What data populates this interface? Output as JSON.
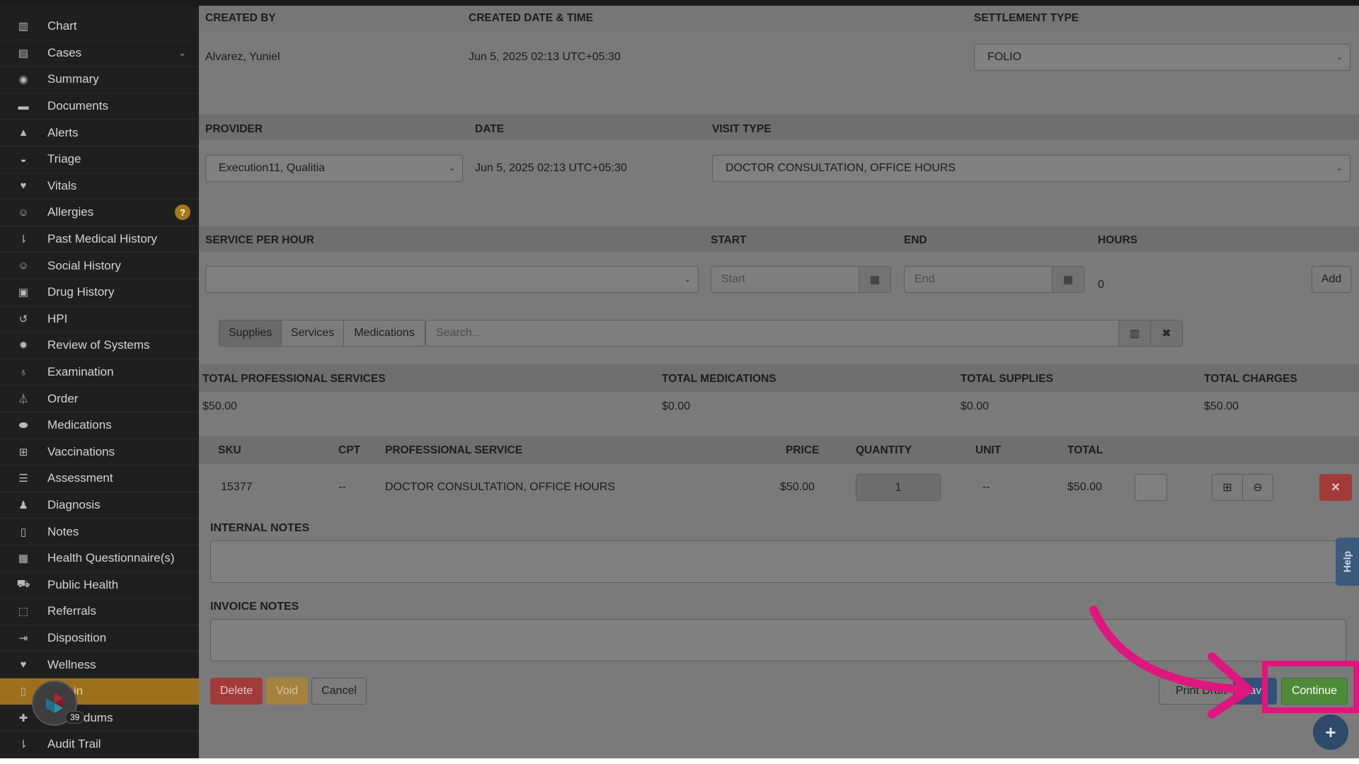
{
  "sidebar": {
    "items": [
      {
        "label": "Chart",
        "icon": "bar-chart-icon",
        "glyph": "▥"
      },
      {
        "label": "Cases",
        "icon": "archive-icon",
        "glyph": "▤",
        "chevron": "⌄"
      },
      {
        "label": "Summary",
        "icon": "eye-icon",
        "glyph": "◉"
      },
      {
        "label": "Documents",
        "icon": "folder-icon",
        "glyph": "▬"
      },
      {
        "label": "Alerts",
        "icon": "warning-icon",
        "glyph": "▲"
      },
      {
        "label": "Triage",
        "icon": "inbox-icon",
        "glyph": "◒"
      },
      {
        "label": "Vitals",
        "icon": "heart-icon",
        "glyph": "♥"
      },
      {
        "label": "Allergies",
        "icon": "face-icon",
        "glyph": "☺",
        "badge": "?"
      },
      {
        "label": "Past Medical History",
        "icon": "sort-icon",
        "glyph": "⇂"
      },
      {
        "label": "Social History",
        "icon": "smile-icon",
        "glyph": "☺"
      },
      {
        "label": "Drug History",
        "icon": "medkit-icon",
        "glyph": "▣"
      },
      {
        "label": "HPI",
        "icon": "history-icon",
        "glyph": "↺"
      },
      {
        "label": "Review of Systems",
        "icon": "cog-icon",
        "glyph": "✹"
      },
      {
        "label": "Examination",
        "icon": "stethoscope-icon",
        "glyph": "♁"
      },
      {
        "label": "Order",
        "icon": "flask-icon",
        "glyph": "⏃"
      },
      {
        "label": "Medications",
        "icon": "pill-icon",
        "glyph": "⬬"
      },
      {
        "label": "Vaccinations",
        "icon": "plus-square-icon",
        "glyph": "⊞"
      },
      {
        "label": "Assessment",
        "icon": "list-icon",
        "glyph": "☰"
      },
      {
        "label": "Diagnosis",
        "icon": "user-md-icon",
        "glyph": "♟"
      },
      {
        "label": "Notes",
        "icon": "file-icon",
        "glyph": "▯"
      },
      {
        "label": "Health Questionnaire(s)",
        "icon": "form-icon",
        "glyph": "▦"
      },
      {
        "label": "Public Health",
        "icon": "ambulance-icon",
        "glyph": "⛟"
      },
      {
        "label": "Referrals",
        "icon": "share-icon",
        "glyph": "⬚"
      },
      {
        "label": "Disposition",
        "icon": "sign-out-icon",
        "glyph": "⇥"
      },
      {
        "label": "Wellness",
        "icon": "heartbeat-icon",
        "glyph": "♥"
      },
      {
        "label": "in",
        "icon": "file-icon",
        "glyph": "▯",
        "active": true
      },
      {
        "label": "dums",
        "icon": "plus-icon",
        "glyph": "✚"
      },
      {
        "label": "Audit Trail",
        "icon": "sort-amount-icon",
        "glyph": "⇂"
      }
    ],
    "floating_count": "39"
  },
  "header_row": {
    "created_by_label": "CREATED BY",
    "created_by_value": "Alvarez, Yuniel",
    "created_dt_label": "CREATED DATE & TIME",
    "created_dt_value": "Jun 5, 2025 02:13 UTC+05:30",
    "settlement_label": "SETTLEMENT TYPE",
    "settlement_value": "FOLIO"
  },
  "provider_row": {
    "provider_label": "PROVIDER",
    "provider_value": "Execution11, Qualitia",
    "date_label": "DATE",
    "date_value": "Jun 5, 2025 02:13 UTC+05:30",
    "visit_label": "VISIT TYPE",
    "visit_value": "DOCTOR CONSULTATION, OFFICE HOURS"
  },
  "service_row": {
    "service_label": "SERVICE PER HOUR",
    "start_label": "START",
    "start_placeholder": "Start",
    "end_label": "END",
    "end_placeholder": "End",
    "hours_label": "HOURS",
    "hours_value": "0",
    "add_label": "Add"
  },
  "tabs": {
    "supplies": "Supplies",
    "services": "Services",
    "medications": "Medications",
    "search_placeholder": "Search..."
  },
  "totals": {
    "prof_label": "TOTAL PROFESSIONAL SERVICES",
    "prof_value": "$50.00",
    "meds_label": "TOTAL MEDICATIONS",
    "meds_value": "$0.00",
    "supplies_label": "TOTAL SUPPLIES",
    "supplies_value": "$0.00",
    "charges_label": "TOTAL CHARGES",
    "charges_value": "$50.00"
  },
  "table": {
    "headers": {
      "sku": "SKU",
      "cpt": "CPT",
      "service": "PROFESSIONAL SERVICE",
      "price": "PRICE",
      "quantity": "QUANTITY",
      "unit": "UNIT",
      "total": "TOTAL"
    },
    "row": {
      "sku": "15377",
      "cpt": "--",
      "service": "DOCTOR CONSULTATION, OFFICE HOURS",
      "price": "$50.00",
      "quantity": "1",
      "unit": "--",
      "total": "$50.00"
    }
  },
  "notes": {
    "internal_label": "INTERNAL NOTES",
    "invoice_label": "INVOICE NOTES"
  },
  "actions": {
    "delete": "Delete",
    "void": "Void",
    "cancel": "Cancel",
    "print_draft": "Print Draft",
    "save": "Save",
    "continue": "Continue"
  },
  "help_label": "Help",
  "colors": {
    "annotation": "#e0167f",
    "continue_green": "#4f8a3b",
    "delete_red": "#a33a3a",
    "void_amber": "#a4823f",
    "save_blue": "#2f517a"
  }
}
